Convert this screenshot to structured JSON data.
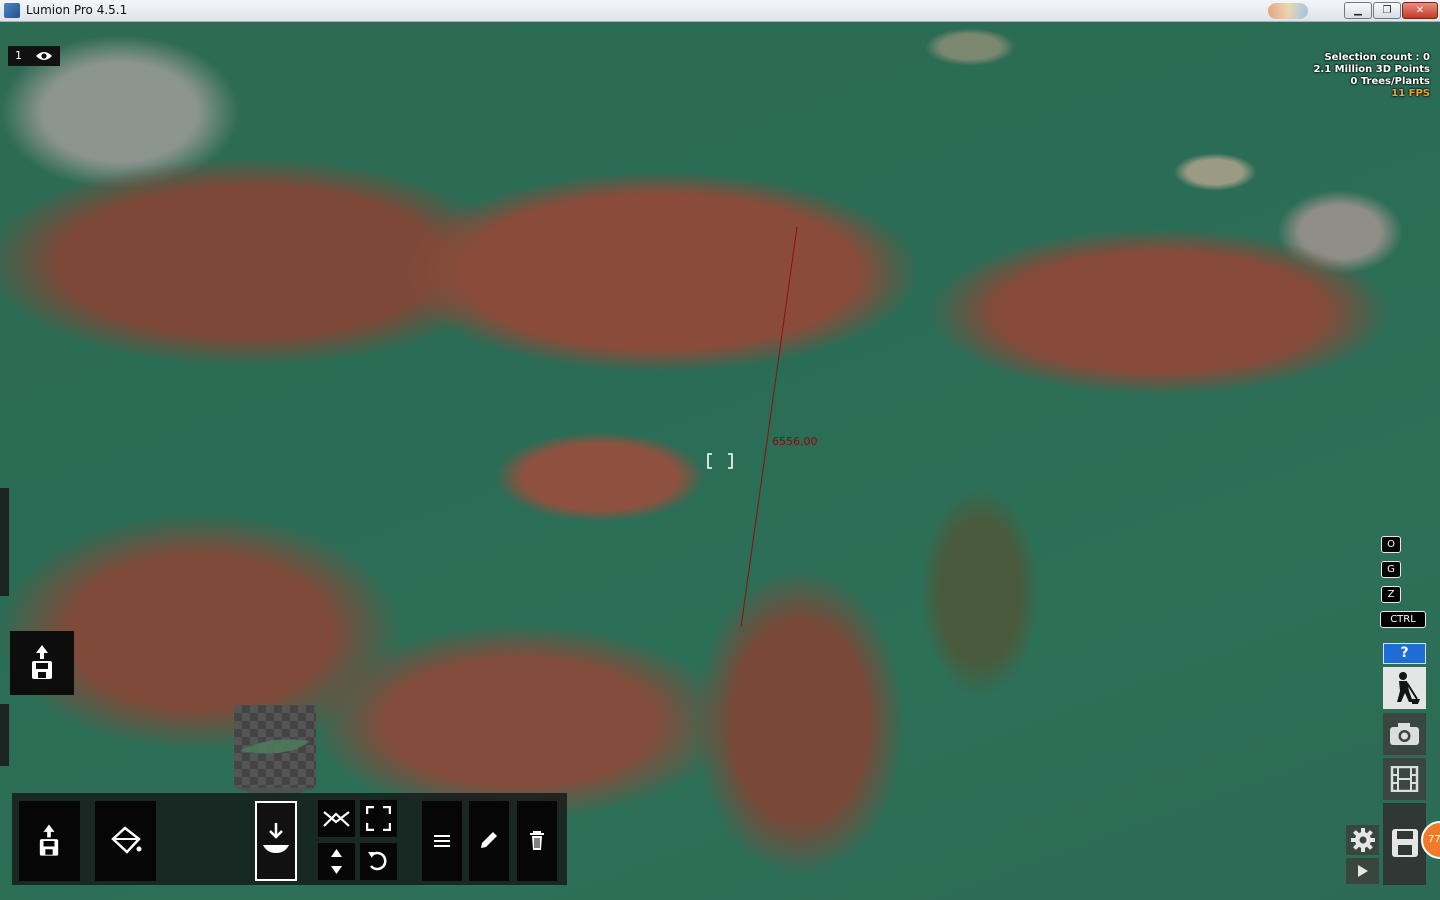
{
  "window": {
    "title": "Lumion Pro 4.5.1",
    "controls": {
      "minimize": "▁",
      "maximize": "❐",
      "close": "✕"
    }
  },
  "viewport": {
    "badge": {
      "number": "1",
      "icon": "eye-icon"
    },
    "stats": {
      "selection": "Selection count : 0",
      "points": "2.1 Million 3D Points",
      "trees": "0 Trees/Plants",
      "fps": "11 FPS",
      "fps_color": "#f2a12a"
    },
    "measurement": "6556.00",
    "measure_color": "#7a0f08"
  },
  "shortcut_keys": {
    "o": "O",
    "g": "G",
    "z": "Z",
    "ctrl": "CTRL"
  },
  "right_panel": {
    "help": "?",
    "modes": [
      "build-mode-icon",
      "photo-mode-icon",
      "movie-mode-icon"
    ],
    "save_icon": "save-icon",
    "settings_icon": "gear-icon",
    "play_icon": "play-icon",
    "update_count": "77",
    "help_color": "#1f6cd6",
    "update_color": "#f07a2a"
  },
  "toolbar": {
    "buttons": [
      "import-icon",
      "paint-icon",
      "place-object-icon",
      "move-icon",
      "scale-icon",
      "height-icon",
      "rotate-icon",
      "list-icon",
      "edit-icon",
      "delete-icon"
    ]
  }
}
